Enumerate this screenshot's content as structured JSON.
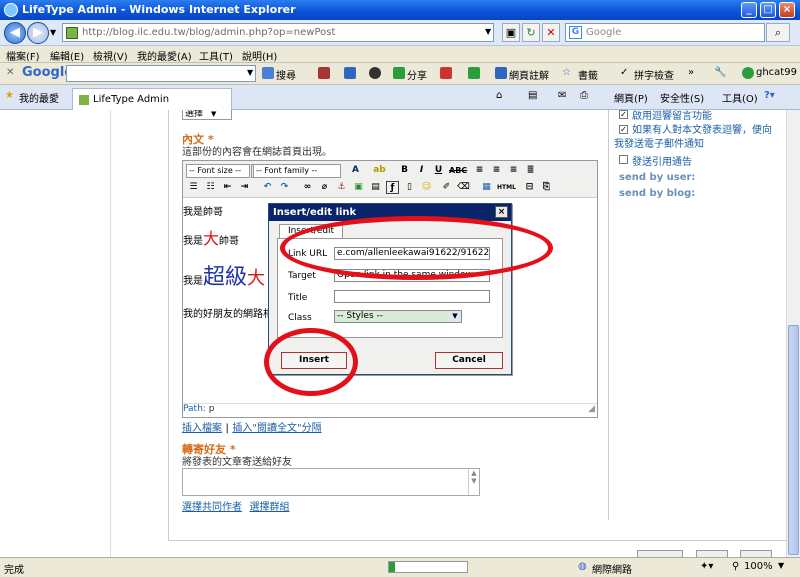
{
  "window": {
    "title": "LifeType Admin - Windows Internet Explorer"
  },
  "address": {
    "url": "http://blog.ilc.edu.tw/blog/admin.php?op=newPost"
  },
  "search": {
    "placeholder": "Google"
  },
  "menu": [
    "檔案(F)",
    "編輯(E)",
    "檢視(V)",
    "我的最愛(A)",
    "工具(T)",
    "說明(H)"
  ],
  "google_toolbar": {
    "brand": "Google",
    "search_label": "搜尋",
    "share_label": "分享",
    "annot_label": "網頁註解",
    "bookmarks_label": "書籤",
    "spell_label": "拼字檢查",
    "more": "»",
    "user": "ghcat99"
  },
  "tabs": {
    "favorites": "我的最愛",
    "current": "LifeType Admin",
    "page_menu": "網頁(P)",
    "safety_menu": "安全性(S)",
    "tools_menu": "工具(O)"
  },
  "editor_section": {
    "top_select": "選擇",
    "label": "內文",
    "required_mark": "*",
    "hint": "這部份的內容會在網誌首頁出現。",
    "font_size": "-- Font size --",
    "font_family": "-- Font family --",
    "lines": {
      "l1": "我是帥哥",
      "l2a": "我是",
      "l2b": "大",
      "l2c": "帥哥",
      "l3a": "我是",
      "l3b": "超級",
      "l3c": "大",
      "l4": "我的好朋友的網路相"
    },
    "path_label": "Path:",
    "path_value": "p",
    "insert_file": "插入檔案",
    "separator": "|",
    "insert_more": "插入\"閱讀全文\"分隔"
  },
  "dialog": {
    "title": "Insert/edit link",
    "tab": "Insert/edit link",
    "url_label": "Link URL",
    "url_value": "e.com/allenleekawai91622/91622#",
    "target_label": "Target",
    "target_value": "Open link in the same window",
    "title_label": "Title",
    "title_value": "",
    "class_label": "Class",
    "class_value": "-- Styles --",
    "insert_button": "Insert",
    "cancel_button": "Cancel"
  },
  "forward_section": {
    "label": "轉寄好友",
    "required_mark": "*",
    "hint": "將發表的文章寄送給好友",
    "coauthor": "選擇共同作者",
    "group": "選擇群組"
  },
  "sidebar": {
    "opt_comments": "啟用迴響留言功能",
    "opt_notify": "如果有人對本文發表迴響，便向我發送電子郵件通知",
    "opt_trackback": "發送引用通告",
    "send_by_user": "send by user:",
    "send_by_blog": "send by blog:"
  },
  "status": {
    "left": "完成",
    "zone": "網際網路",
    "zoom": "100%"
  },
  "colors": {
    "accent": "#0a246a",
    "highlight": "#e3101a",
    "label": "#d56d1c",
    "link": "#1c5fa8"
  }
}
